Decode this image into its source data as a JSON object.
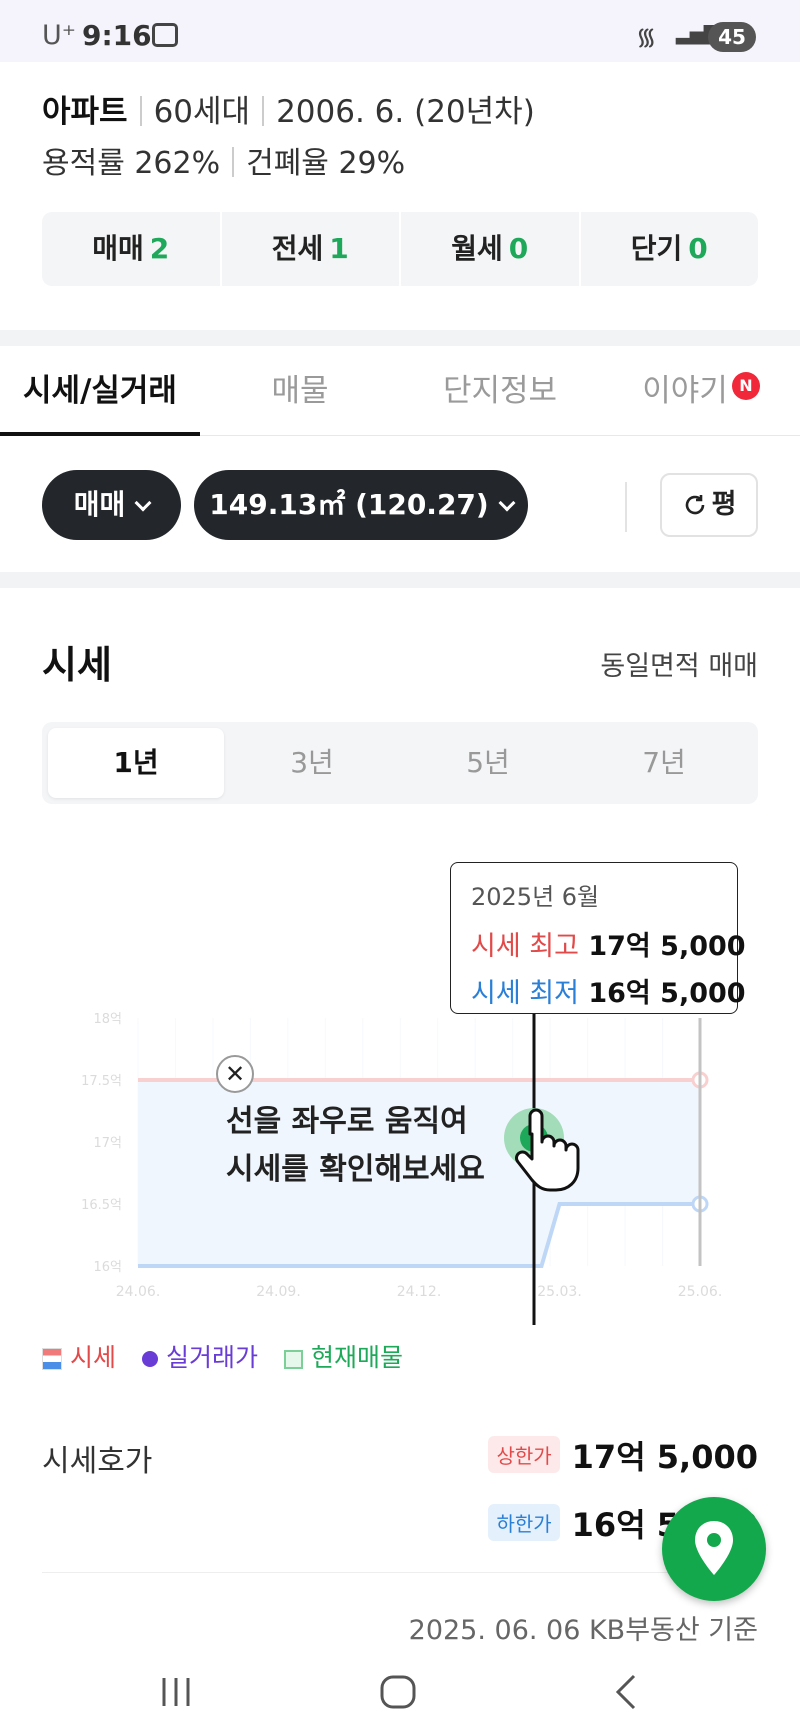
{
  "status_bar": {
    "carrier": "U⁺",
    "time": "9:16",
    "battery": "45"
  },
  "info": {
    "type": "아파트",
    "households": "60세대",
    "built": "2006. 6.",
    "age": "(20년차)",
    "floor_area_ratio": "용적률 262%",
    "building_coverage": "건폐율 29%"
  },
  "counts": [
    {
      "label": "매매",
      "value": "2"
    },
    {
      "label": "전세",
      "value": "1"
    },
    {
      "label": "월세",
      "value": "0"
    },
    {
      "label": "단기",
      "value": "0"
    }
  ],
  "tabs": [
    {
      "label": "시세/실거래",
      "active": true
    },
    {
      "label": "매물"
    },
    {
      "label": "단지정보"
    },
    {
      "label": "이야기",
      "badge": "N"
    }
  ],
  "filters": {
    "deal_type": "매매",
    "area": "149.13㎡ (120.27)",
    "unit_toggle": "평"
  },
  "section": {
    "title": "시세",
    "filter_label": "동일면적 매매"
  },
  "periods": [
    "1년",
    "3년",
    "5년",
    "7년"
  ],
  "active_period": "1년",
  "tooltip": {
    "date": "2025년 6월",
    "high_label": "시세 최고",
    "high_value": "17억 5,000",
    "low_label": "시세 최저",
    "low_value": "16억 5,000"
  },
  "coach_mark": {
    "close": "✕",
    "line1": "선을 좌우로 움직여",
    "line2": "시세를 확인해보세요"
  },
  "legend": {
    "sise": "시세",
    "real": "실거래가",
    "current": "현재매물"
  },
  "colors": {
    "accent_green": "#1ea95a",
    "high_red": "#e24a4a",
    "low_blue": "#2a7fd6",
    "real_purple": "#6a3cd6",
    "fab_green": "#13a84c"
  },
  "quote": {
    "label": "시세호가",
    "upper_tag": "상한가",
    "upper_value": "17억 5,000",
    "lower_tag": "하한가",
    "lower_value": "16억 5,000"
  },
  "basis": "2025. 06. 06 KB부동산 기준",
  "icons": {
    "map_fab": "map-pin-icon",
    "refresh": "refresh-icon",
    "nav": [
      "recent-apps-icon",
      "home-icon",
      "back-icon"
    ]
  },
  "chart_data": {
    "type": "line",
    "x": [
      "24.06.",
      "24.09.",
      "24.12.",
      "25.03.",
      "25.06."
    ],
    "ylim": [
      16.0,
      18.0
    ],
    "series": [
      {
        "name": "시세 최고",
        "values": [
          17.5,
          17.5,
          17.5,
          17.5,
          17.5
        ]
      },
      {
        "name": "시세 최저",
        "values": [
          16.0,
          16.0,
          16.0,
          16.5,
          16.5
        ]
      }
    ],
    "y_ticks": [
      "16억",
      "16.5억",
      "17억",
      "17.5억",
      "18억"
    ],
    "selected_x": "25.06."
  }
}
